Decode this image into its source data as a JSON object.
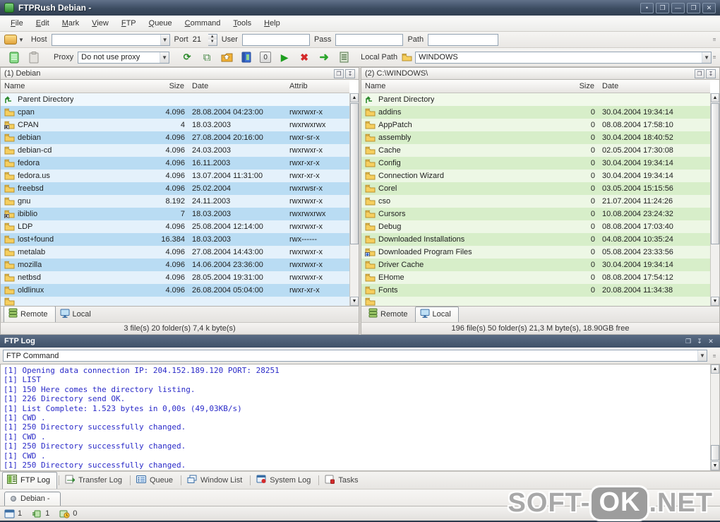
{
  "window": {
    "title": "FTPRush Debian -",
    "buttons": [
      {
        "name": "options",
        "glyph": "•"
      },
      {
        "name": "stay-on-top",
        "glyph": "❐"
      },
      {
        "name": "minimize",
        "glyph": "—"
      },
      {
        "name": "restore",
        "glyph": "❐"
      },
      {
        "name": "close",
        "glyph": "✕"
      }
    ]
  },
  "menu": [
    "File",
    "Edit",
    "Mark",
    "View",
    "FTP",
    "Queue",
    "Command",
    "Tools",
    "Help"
  ],
  "toolbar_connect": {
    "host_label": "Host",
    "host_value": "",
    "port_label": "Port",
    "port_value": "21",
    "user_label": "User",
    "user_value": "",
    "pass_label": "Pass",
    "pass_value": "",
    "path_label": "Path",
    "path_value": ""
  },
  "toolbar_actions": {
    "proxy_label": "Proxy",
    "proxy_value": "Do not use proxy",
    "icons": [
      "new-session-icon",
      "clipboard-icon",
      "transfer-mode-icon",
      "copy-icon",
      "upload-folder-icon",
      "address-book-icon",
      "zero-badge-icon",
      "start-transfer-icon",
      "stop-icon",
      "go-icon",
      "log-list-icon"
    ],
    "local_path_label": "Local Path",
    "local_path_value": "WINDOWS"
  },
  "left_panel": {
    "title": "(1) Debian",
    "columns": [
      "Name",
      "Size",
      "Date",
      "Attrib"
    ],
    "parent_label": "Parent Directory",
    "rows": [
      {
        "name": "cpan",
        "size": "4.096",
        "date": "28.08.2004 04:23:00",
        "attrib": "rwxrwxr-x",
        "icon": "folder"
      },
      {
        "name": "CPAN",
        "size": "4",
        "date": "18.03.2003",
        "attrib": "rwxrwxrwx",
        "icon": "folder-link"
      },
      {
        "name": "debian",
        "size": "4.096",
        "date": "27.08.2004 20:16:00",
        "attrib": "rwxr-sr-x",
        "icon": "folder"
      },
      {
        "name": "debian-cd",
        "size": "4.096",
        "date": "24.03.2003",
        "attrib": "rwxrwxr-x",
        "icon": "folder"
      },
      {
        "name": "fedora",
        "size": "4.096",
        "date": "16.11.2003",
        "attrib": "rwxr-xr-x",
        "icon": "folder"
      },
      {
        "name": "fedora.us",
        "size": "4.096",
        "date": "13.07.2004 11:31:00",
        "attrib": "rwxr-xr-x",
        "icon": "folder"
      },
      {
        "name": "freebsd",
        "size": "4.096",
        "date": "25.02.2004",
        "attrib": "rwxrwsr-x",
        "icon": "folder"
      },
      {
        "name": "gnu",
        "size": "8.192",
        "date": "24.11.2003",
        "attrib": "rwxrwxr-x",
        "icon": "folder"
      },
      {
        "name": "ibiblio",
        "size": "7",
        "date": "18.03.2003",
        "attrib": "rwxrwxrwx",
        "icon": "folder-link"
      },
      {
        "name": "LDP",
        "size": "4.096",
        "date": "25.08.2004 12:14:00",
        "attrib": "rwxrwxr-x",
        "icon": "folder"
      },
      {
        "name": "lost+found",
        "size": "16.384",
        "date": "18.03.2003",
        "attrib": "rwx------",
        "icon": "folder"
      },
      {
        "name": "metalab",
        "size": "4.096",
        "date": "27.08.2004 14:43:00",
        "attrib": "rwxrwxr-x",
        "icon": "folder"
      },
      {
        "name": "mozilla",
        "size": "4.096",
        "date": "14.06.2004 23:36:00",
        "attrib": "rwxrwxr-x",
        "icon": "folder"
      },
      {
        "name": "netbsd",
        "size": "4.096",
        "date": "28.05.2004 19:31:00",
        "attrib": "rwxrwxr-x",
        "icon": "folder"
      },
      {
        "name": "oldlinux",
        "size": "4.096",
        "date": "26.08.2004 05:04:00",
        "attrib": "rwxr-xr-x",
        "icon": "folder"
      }
    ],
    "tabs": [
      {
        "label": "Remote",
        "icon": "remote-server-icon",
        "active": true
      },
      {
        "label": "Local",
        "icon": "local-computer-icon",
        "active": false
      }
    ],
    "status": "3 file(s) 20 folder(s) 7,4 k byte(s)"
  },
  "right_panel": {
    "title": "(2) C:\\WINDOWS\\",
    "columns": [
      "Name",
      "Size",
      "Date"
    ],
    "parent_label": "Parent Directory",
    "rows": [
      {
        "name": "addins",
        "size": "0",
        "date": "30.04.2004 19:34:14",
        "icon": "folder"
      },
      {
        "name": "AppPatch",
        "size": "0",
        "date": "08.08.2004 17:58:10",
        "icon": "folder"
      },
      {
        "name": "assembly",
        "size": "0",
        "date": "30.04.2004 18:40:52",
        "icon": "folder"
      },
      {
        "name": "Cache",
        "size": "0",
        "date": "02.05.2004 17:30:08",
        "icon": "folder"
      },
      {
        "name": "Config",
        "size": "0",
        "date": "30.04.2004 19:34:14",
        "icon": "folder"
      },
      {
        "name": "Connection Wizard",
        "size": "0",
        "date": "30.04.2004 19:34:14",
        "icon": "folder"
      },
      {
        "name": "Corel",
        "size": "0",
        "date": "03.05.2004 15:15:56",
        "icon": "folder"
      },
      {
        "name": "cso",
        "size": "0",
        "date": "21.07.2004 11:24:26",
        "icon": "folder"
      },
      {
        "name": "Cursors",
        "size": "0",
        "date": "10.08.2004 23:24:32",
        "icon": "folder"
      },
      {
        "name": "Debug",
        "size": "0",
        "date": "08.08.2004 17:03:40",
        "icon": "folder"
      },
      {
        "name": "Downloaded Installations",
        "size": "0",
        "date": "04.08.2004 10:35:24",
        "icon": "folder"
      },
      {
        "name": "Downloaded Program Files",
        "size": "0",
        "date": "05.08.2004 23:33:56",
        "icon": "folder-program"
      },
      {
        "name": "Driver Cache",
        "size": "0",
        "date": "30.04.2004 19:34:14",
        "icon": "folder"
      },
      {
        "name": "EHome",
        "size": "0",
        "date": "08.08.2004 17:54:12",
        "icon": "folder"
      },
      {
        "name": "Fonts",
        "size": "0",
        "date": "20.08.2004 11:34:38",
        "icon": "folder"
      }
    ],
    "tabs": [
      {
        "label": "Remote",
        "icon": "remote-server-icon",
        "active": false
      },
      {
        "label": "Local",
        "icon": "local-computer-icon",
        "active": true
      }
    ],
    "status": "196 file(s) 50 folder(s) 21,3 M byte(s), 18.90GB free"
  },
  "log_panel": {
    "title": "FTP Log",
    "command_value": "FTP Command",
    "lines": [
      "[1] Opening data connection IP: 204.152.189.120 PORT: 28251",
      "[1] LIST",
      "[1] 150 Here comes the directory listing.",
      "[1] 226 Directory send OK.",
      "[1] List Complete: 1.523 bytes in 0,00s (49,03KB/s)",
      "[1] CWD .",
      "[1] 250 Directory successfully changed.",
      "[1] CWD .",
      "[1] 250 Directory successfully changed.",
      "[1] CWD .",
      "[1] 250 Directory successfully changed."
    ]
  },
  "bottom_tabs": [
    {
      "label": "FTP Log",
      "icon": "ftp-log-icon",
      "active": true
    },
    {
      "label": "Transfer Log",
      "icon": "transfer-log-icon",
      "active": false
    },
    {
      "label": "Queue",
      "icon": "queue-icon",
      "active": false
    },
    {
      "label": "Window List",
      "icon": "window-list-icon",
      "active": false
    },
    {
      "label": "System Log",
      "icon": "system-log-icon",
      "active": false
    },
    {
      "label": "Tasks",
      "icon": "tasks-icon",
      "active": false
    }
  ],
  "window_tabs": [
    {
      "label": "Debian -"
    }
  ],
  "statusbar": {
    "windows_count": "1",
    "connections_count": "1",
    "tasks_count": "0"
  },
  "watermark": {
    "text_before": "SOFT-",
    "badge": "OK",
    "text_after": ".NET"
  },
  "colors": {
    "titlebar": "#3c4c61",
    "row_blue_dark": "#b9dcf3",
    "row_blue_light": "#e4f1fb",
    "parent_blue": "#eff7fd",
    "row_green_dark": "#d7eec9",
    "row_green_light": "#edf7e5",
    "parent_green": "#f1f9ea",
    "log_text": "#2a2ac8",
    "log_header": "#3f5168"
  }
}
